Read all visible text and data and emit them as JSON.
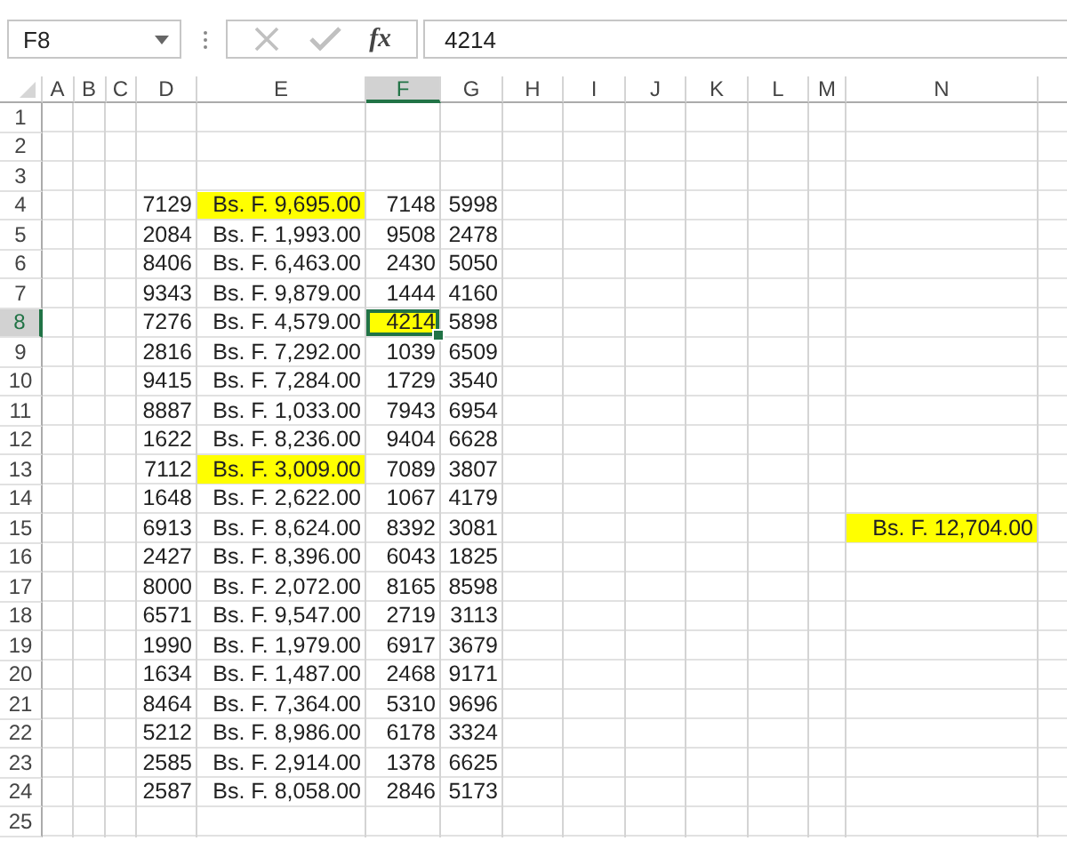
{
  "formula_bar": {
    "name_box": "F8",
    "function_label": "fx",
    "formula": "4214"
  },
  "columns": [
    {
      "label": "A",
      "selected": false
    },
    {
      "label": "B",
      "selected": false
    },
    {
      "label": "C",
      "selected": false
    },
    {
      "label": "D",
      "selected": false
    },
    {
      "label": "E",
      "selected": false
    },
    {
      "label": "F",
      "selected": true
    },
    {
      "label": "G",
      "selected": false
    },
    {
      "label": "H",
      "selected": false
    },
    {
      "label": "I",
      "selected": false
    },
    {
      "label": "J",
      "selected": false
    },
    {
      "label": "K",
      "selected": false
    },
    {
      "label": "L",
      "selected": false
    },
    {
      "label": "M",
      "selected": false
    },
    {
      "label": "N",
      "selected": false
    }
  ],
  "rows": [
    {
      "label": "1",
      "selected": false,
      "cells": {}
    },
    {
      "label": "2",
      "selected": false,
      "cells": {}
    },
    {
      "label": "3",
      "selected": false,
      "cells": {}
    },
    {
      "label": "4",
      "selected": false,
      "cells": {
        "D": {
          "text": "7129",
          "highlighted": false,
          "active": false
        },
        "E": {
          "text": "Bs. F. 9,695.00",
          "highlighted": true,
          "active": false
        },
        "F": {
          "text": "7148",
          "highlighted": false,
          "active": false
        },
        "G": {
          "text": "5998",
          "highlighted": false,
          "active": false
        }
      }
    },
    {
      "label": "5",
      "selected": false,
      "cells": {
        "D": {
          "text": "2084",
          "highlighted": false,
          "active": false
        },
        "E": {
          "text": "Bs. F. 1,993.00",
          "highlighted": false,
          "active": false
        },
        "F": {
          "text": "9508",
          "highlighted": false,
          "active": false
        },
        "G": {
          "text": "2478",
          "highlighted": false,
          "active": false
        }
      }
    },
    {
      "label": "6",
      "selected": false,
      "cells": {
        "D": {
          "text": "8406",
          "highlighted": false,
          "active": false
        },
        "E": {
          "text": "Bs. F. 6,463.00",
          "highlighted": false,
          "active": false
        },
        "F": {
          "text": "2430",
          "highlighted": false,
          "active": false
        },
        "G": {
          "text": "5050",
          "highlighted": false,
          "active": false
        }
      }
    },
    {
      "label": "7",
      "selected": false,
      "cells": {
        "D": {
          "text": "9343",
          "highlighted": false,
          "active": false
        },
        "E": {
          "text": "Bs. F. 9,879.00",
          "highlighted": false,
          "active": false
        },
        "F": {
          "text": "1444",
          "highlighted": false,
          "active": false
        },
        "G": {
          "text": "4160",
          "highlighted": false,
          "active": false
        }
      }
    },
    {
      "label": "8",
      "selected": true,
      "cells": {
        "D": {
          "text": "7276",
          "highlighted": false,
          "active": false
        },
        "E": {
          "text": "Bs. F. 4,579.00",
          "highlighted": false,
          "active": false
        },
        "F": {
          "text": "4214",
          "highlighted": true,
          "active": true
        },
        "G": {
          "text": "5898",
          "highlighted": false,
          "active": false
        }
      }
    },
    {
      "label": "9",
      "selected": false,
      "cells": {
        "D": {
          "text": "2816",
          "highlighted": false,
          "active": false
        },
        "E": {
          "text": "Bs. F. 7,292.00",
          "highlighted": false,
          "active": false
        },
        "F": {
          "text": "1039",
          "highlighted": false,
          "active": false
        },
        "G": {
          "text": "6509",
          "highlighted": false,
          "active": false
        }
      }
    },
    {
      "label": "10",
      "selected": false,
      "cells": {
        "D": {
          "text": "9415",
          "highlighted": false,
          "active": false
        },
        "E": {
          "text": "Bs. F. 7,284.00",
          "highlighted": false,
          "active": false
        },
        "F": {
          "text": "1729",
          "highlighted": false,
          "active": false
        },
        "G": {
          "text": "3540",
          "highlighted": false,
          "active": false
        }
      }
    },
    {
      "label": "11",
      "selected": false,
      "cells": {
        "D": {
          "text": "8887",
          "highlighted": false,
          "active": false
        },
        "E": {
          "text": "Bs. F. 1,033.00",
          "highlighted": false,
          "active": false
        },
        "F": {
          "text": "7943",
          "highlighted": false,
          "active": false
        },
        "G": {
          "text": "6954",
          "highlighted": false,
          "active": false
        }
      }
    },
    {
      "label": "12",
      "selected": false,
      "cells": {
        "D": {
          "text": "1622",
          "highlighted": false,
          "active": false
        },
        "E": {
          "text": "Bs. F. 8,236.00",
          "highlighted": false,
          "active": false
        },
        "F": {
          "text": "9404",
          "highlighted": false,
          "active": false
        },
        "G": {
          "text": "6628",
          "highlighted": false,
          "active": false
        }
      }
    },
    {
      "label": "13",
      "selected": false,
      "cells": {
        "D": {
          "text": "7112",
          "highlighted": false,
          "active": false
        },
        "E": {
          "text": "Bs. F. 3,009.00",
          "highlighted": true,
          "active": false
        },
        "F": {
          "text": "7089",
          "highlighted": false,
          "active": false
        },
        "G": {
          "text": "3807",
          "highlighted": false,
          "active": false
        }
      }
    },
    {
      "label": "14",
      "selected": false,
      "cells": {
        "D": {
          "text": "1648",
          "highlighted": false,
          "active": false
        },
        "E": {
          "text": "Bs. F. 2,622.00",
          "highlighted": false,
          "active": false
        },
        "F": {
          "text": "1067",
          "highlighted": false,
          "active": false
        },
        "G": {
          "text": "4179",
          "highlighted": false,
          "active": false
        }
      }
    },
    {
      "label": "15",
      "selected": false,
      "cells": {
        "D": {
          "text": "6913",
          "highlighted": false,
          "active": false
        },
        "E": {
          "text": "Bs. F. 8,624.00",
          "highlighted": false,
          "active": false
        },
        "F": {
          "text": "8392",
          "highlighted": false,
          "active": false
        },
        "G": {
          "text": "3081",
          "highlighted": false,
          "active": false
        },
        "N": {
          "text": "Bs. F. 12,704.00",
          "highlighted": true,
          "active": false
        }
      }
    },
    {
      "label": "16",
      "selected": false,
      "cells": {
        "D": {
          "text": "2427",
          "highlighted": false,
          "active": false
        },
        "E": {
          "text": "Bs. F. 8,396.00",
          "highlighted": false,
          "active": false
        },
        "F": {
          "text": "6043",
          "highlighted": false,
          "active": false
        },
        "G": {
          "text": "1825",
          "highlighted": false,
          "active": false
        }
      }
    },
    {
      "label": "17",
      "selected": false,
      "cells": {
        "D": {
          "text": "8000",
          "highlighted": false,
          "active": false
        },
        "E": {
          "text": "Bs. F. 2,072.00",
          "highlighted": false,
          "active": false
        },
        "F": {
          "text": "8165",
          "highlighted": false,
          "active": false
        },
        "G": {
          "text": "8598",
          "highlighted": false,
          "active": false
        }
      }
    },
    {
      "label": "18",
      "selected": false,
      "cells": {
        "D": {
          "text": "6571",
          "highlighted": false,
          "active": false
        },
        "E": {
          "text": "Bs. F. 9,547.00",
          "highlighted": false,
          "active": false
        },
        "F": {
          "text": "2719",
          "highlighted": false,
          "active": false
        },
        "G": {
          "text": "3113",
          "highlighted": false,
          "active": false
        }
      }
    },
    {
      "label": "19",
      "selected": false,
      "cells": {
        "D": {
          "text": "1990",
          "highlighted": false,
          "active": false
        },
        "E": {
          "text": "Bs. F. 1,979.00",
          "highlighted": false,
          "active": false
        },
        "F": {
          "text": "6917",
          "highlighted": false,
          "active": false
        },
        "G": {
          "text": "3679",
          "highlighted": false,
          "active": false
        }
      }
    },
    {
      "label": "20",
      "selected": false,
      "cells": {
        "D": {
          "text": "1634",
          "highlighted": false,
          "active": false
        },
        "E": {
          "text": "Bs. F. 1,487.00",
          "highlighted": false,
          "active": false
        },
        "F": {
          "text": "2468",
          "highlighted": false,
          "active": false
        },
        "G": {
          "text": "9171",
          "highlighted": false,
          "active": false
        }
      }
    },
    {
      "label": "21",
      "selected": false,
      "cells": {
        "D": {
          "text": "8464",
          "highlighted": false,
          "active": false
        },
        "E": {
          "text": "Bs. F. 7,364.00",
          "highlighted": false,
          "active": false
        },
        "F": {
          "text": "5310",
          "highlighted": false,
          "active": false
        },
        "G": {
          "text": "9696",
          "highlighted": false,
          "active": false
        }
      }
    },
    {
      "label": "22",
      "selected": false,
      "cells": {
        "D": {
          "text": "5212",
          "highlighted": false,
          "active": false
        },
        "E": {
          "text": "Bs. F. 8,986.00",
          "highlighted": false,
          "active": false
        },
        "F": {
          "text": "6178",
          "highlighted": false,
          "active": false
        },
        "G": {
          "text": "3324",
          "highlighted": false,
          "active": false
        }
      }
    },
    {
      "label": "23",
      "selected": false,
      "cells": {
        "D": {
          "text": "2585",
          "highlighted": false,
          "active": false
        },
        "E": {
          "text": "Bs. F. 2,914.00",
          "highlighted": false,
          "active": false
        },
        "F": {
          "text": "1378",
          "highlighted": false,
          "active": false
        },
        "G": {
          "text": "6625",
          "highlighted": false,
          "active": false
        }
      }
    },
    {
      "label": "24",
      "selected": false,
      "cells": {
        "D": {
          "text": "2587",
          "highlighted": false,
          "active": false
        },
        "E": {
          "text": "Bs. F. 8,058.00",
          "highlighted": false,
          "active": false
        },
        "F": {
          "text": "2846",
          "highlighted": false,
          "active": false
        },
        "G": {
          "text": "5173",
          "highlighted": false,
          "active": false
        }
      }
    },
    {
      "label": "25",
      "selected": false,
      "cells": {}
    }
  ]
}
